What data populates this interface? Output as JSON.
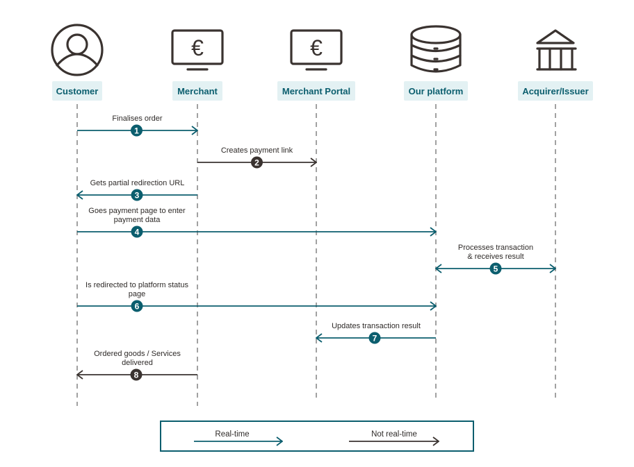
{
  "colors": {
    "realtime": "#0b5e6e",
    "not_realtime": "#3a3330",
    "label_bg": "#e3f1f3",
    "label_text": "#0b5e6e"
  },
  "actors": [
    {
      "id": "customer",
      "label": "Customer",
      "icon": "user-circle-icon"
    },
    {
      "id": "merchant",
      "label": "Merchant",
      "icon": "monitor-euro-icon"
    },
    {
      "id": "portal",
      "label": "Merchant Portal",
      "icon": "monitor-euro-icon"
    },
    {
      "id": "platform",
      "label": "Our platform",
      "icon": "database-icon"
    },
    {
      "id": "acquirer",
      "label": "Acquirer/Issuer",
      "icon": "bank-icon"
    }
  ],
  "messages": [
    {
      "step": "1",
      "from": "customer",
      "to": "merchant",
      "lines": [
        "Finalises order"
      ],
      "type": "realtime"
    },
    {
      "step": "2",
      "from": "merchant",
      "to": "portal",
      "lines": [
        "Creates payment link"
      ],
      "type": "not_realtime"
    },
    {
      "step": "3",
      "from": "merchant",
      "to": "customer",
      "lines": [
        "Gets partial redirection URL"
      ],
      "type": "realtime"
    },
    {
      "step": "4",
      "from": "customer",
      "to": "platform",
      "lines": [
        "Goes payment page to enter",
        "payment data"
      ],
      "type": "realtime"
    },
    {
      "step": "5",
      "from": "platform",
      "to": "acquirer",
      "lines": [
        "Processes transaction",
        "& receives result"
      ],
      "type": "realtime",
      "bidirectional": true
    },
    {
      "step": "6",
      "from": "customer",
      "to": "platform",
      "lines": [
        "Is redirected to platform status",
        "page"
      ],
      "type": "realtime"
    },
    {
      "step": "7",
      "from": "platform",
      "to": "portal",
      "lines": [
        "Updates transaction result"
      ],
      "type": "realtime"
    },
    {
      "step": "8",
      "from": "merchant",
      "to": "customer",
      "lines": [
        "Ordered goods / Services",
        "delivered"
      ],
      "type": "not_realtime"
    }
  ],
  "legend": {
    "realtime_label": "Real-time",
    "not_realtime_label": "Not real-time"
  }
}
